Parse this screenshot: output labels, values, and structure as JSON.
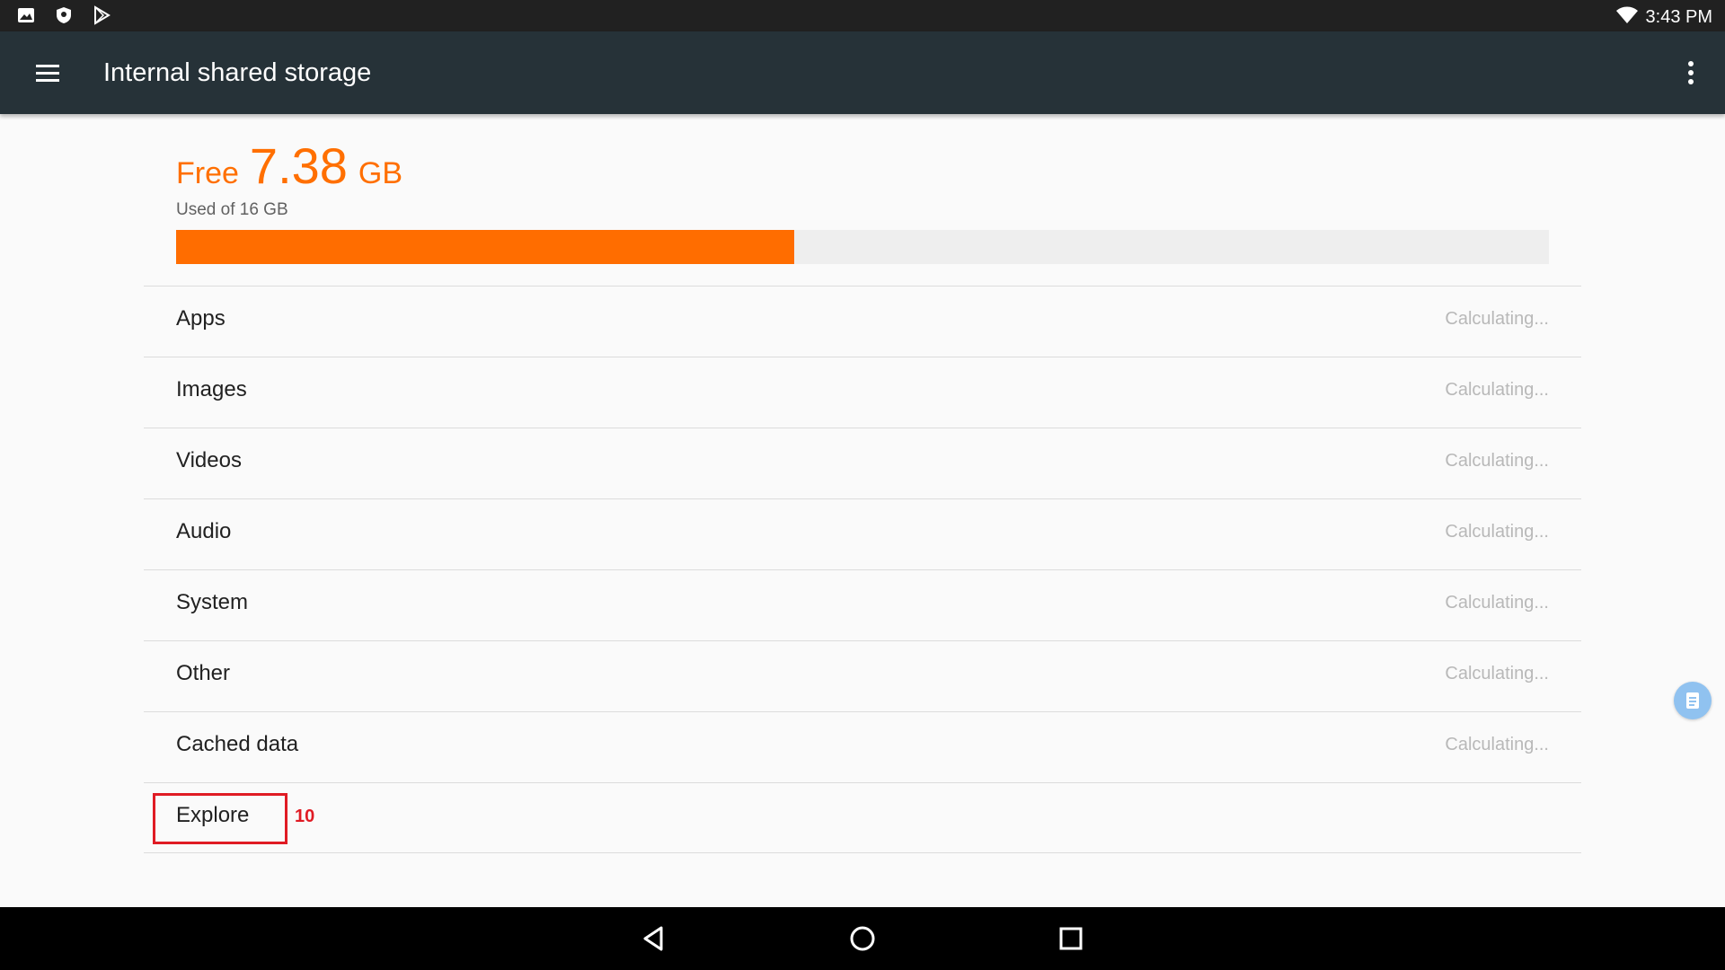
{
  "status_bar": {
    "time": "3:43 PM",
    "left_icons": [
      "image-icon",
      "shield-icon",
      "play-store-icon"
    ],
    "right_icons": [
      "wifi-icon"
    ]
  },
  "toolbar": {
    "title": "Internal shared storage",
    "menu_icon": "hamburger-menu-icon",
    "overflow_icon": "more-vert-icon"
  },
  "storage": {
    "free_label": "Free",
    "free_value": "7.38",
    "free_unit": "GB",
    "used_text": "Used of 16 GB",
    "used_fraction": 0.45
  },
  "categories": [
    {
      "label": "Apps",
      "value": "Calculating..."
    },
    {
      "label": "Images",
      "value": "Calculating..."
    },
    {
      "label": "Videos",
      "value": "Calculating..."
    },
    {
      "label": "Audio",
      "value": "Calculating..."
    },
    {
      "label": "System",
      "value": "Calculating..."
    },
    {
      "label": "Other",
      "value": "Calculating..."
    },
    {
      "label": "Cached data",
      "value": "Calculating..."
    },
    {
      "label": "Explore",
      "value": ""
    }
  ],
  "annotation": {
    "number": "10"
  },
  "colors": {
    "accent": "#ff6d00",
    "toolbar": "#263238",
    "highlight": "#e01b24"
  },
  "nav_bar": {
    "icons": [
      "back-icon",
      "home-icon",
      "recents-icon"
    ]
  }
}
